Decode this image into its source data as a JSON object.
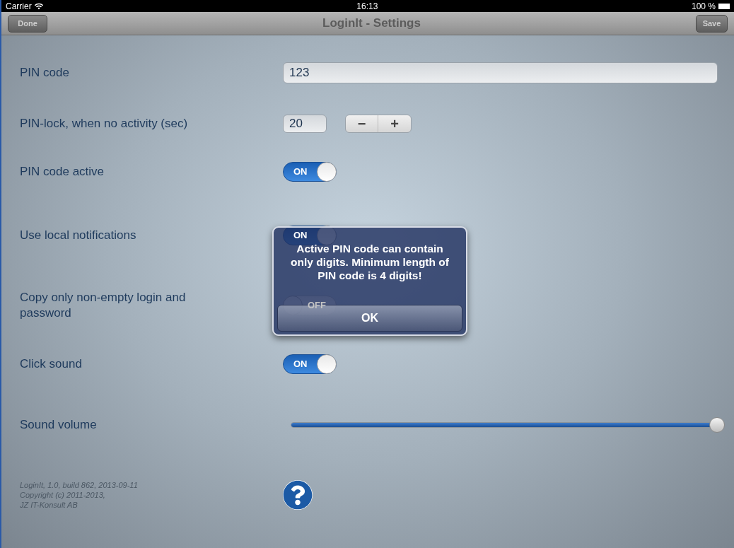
{
  "status_bar": {
    "carrier": "Carrier",
    "time": "16:13",
    "battery": "100 %"
  },
  "nav_bar": {
    "title": "LoginIt - Settings",
    "left_button": "Done",
    "right_button": "Save"
  },
  "settings": [
    {
      "kind": "text",
      "label": "PIN code",
      "value": "123"
    },
    {
      "kind": "stepper",
      "label": "PIN-lock, when no activity (sec)",
      "value": "20",
      "minus": "−",
      "plus": "+"
    },
    {
      "kind": "switch",
      "label": "PIN code active",
      "on": true,
      "state_label": "ON"
    },
    {
      "kind": "switch",
      "label": "Use local notifications",
      "on": true,
      "state_label": "ON"
    },
    {
      "kind": "switch",
      "label": "Copy only non-empty login and password",
      "on": false,
      "state_label": "OFF"
    },
    {
      "kind": "switch",
      "label": "Click sound",
      "on": true,
      "state_label": "ON"
    },
    {
      "kind": "slider",
      "label": "Sound volume",
      "level": 1.0
    }
  ],
  "footer": {
    "lines": [
      "LoginIt, 1.0, build 862, 2013-09-11",
      "Copyright (c) 2011-2013,",
      "JZ IT-Konsult AB"
    ]
  },
  "alert": {
    "message": "Active PIN code can contain only digits. Minimum length of PIN code is 4 digits!",
    "button": "OK"
  }
}
